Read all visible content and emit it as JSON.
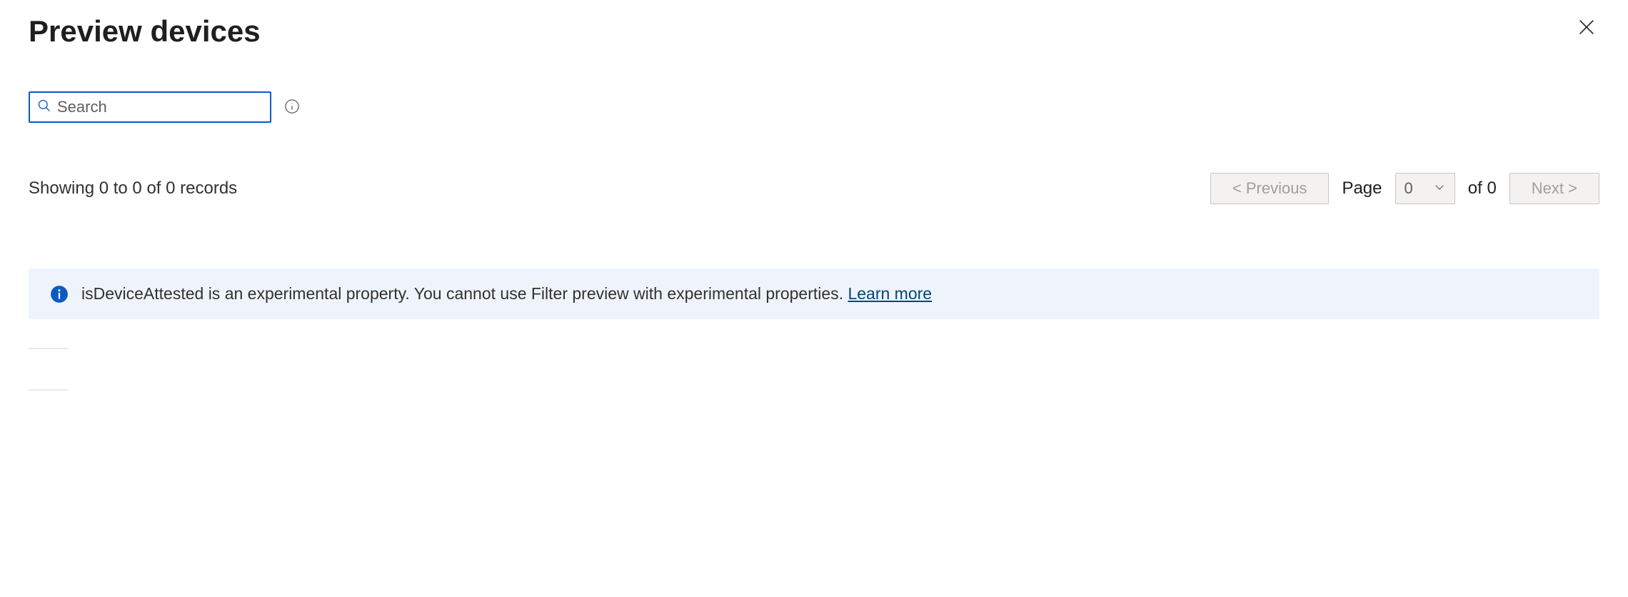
{
  "header": {
    "title": "Preview devices"
  },
  "search": {
    "placeholder": "Search"
  },
  "records": {
    "summary": "Showing 0 to 0 of 0 records"
  },
  "pager": {
    "previous": "< Previous",
    "page_label": "Page",
    "page_value": "0",
    "of_text": "of 0",
    "next": "Next >"
  },
  "banner": {
    "message": "isDeviceAttested is an experimental property. You cannot use Filter preview with experimental properties. ",
    "learn_more": "Learn more"
  }
}
